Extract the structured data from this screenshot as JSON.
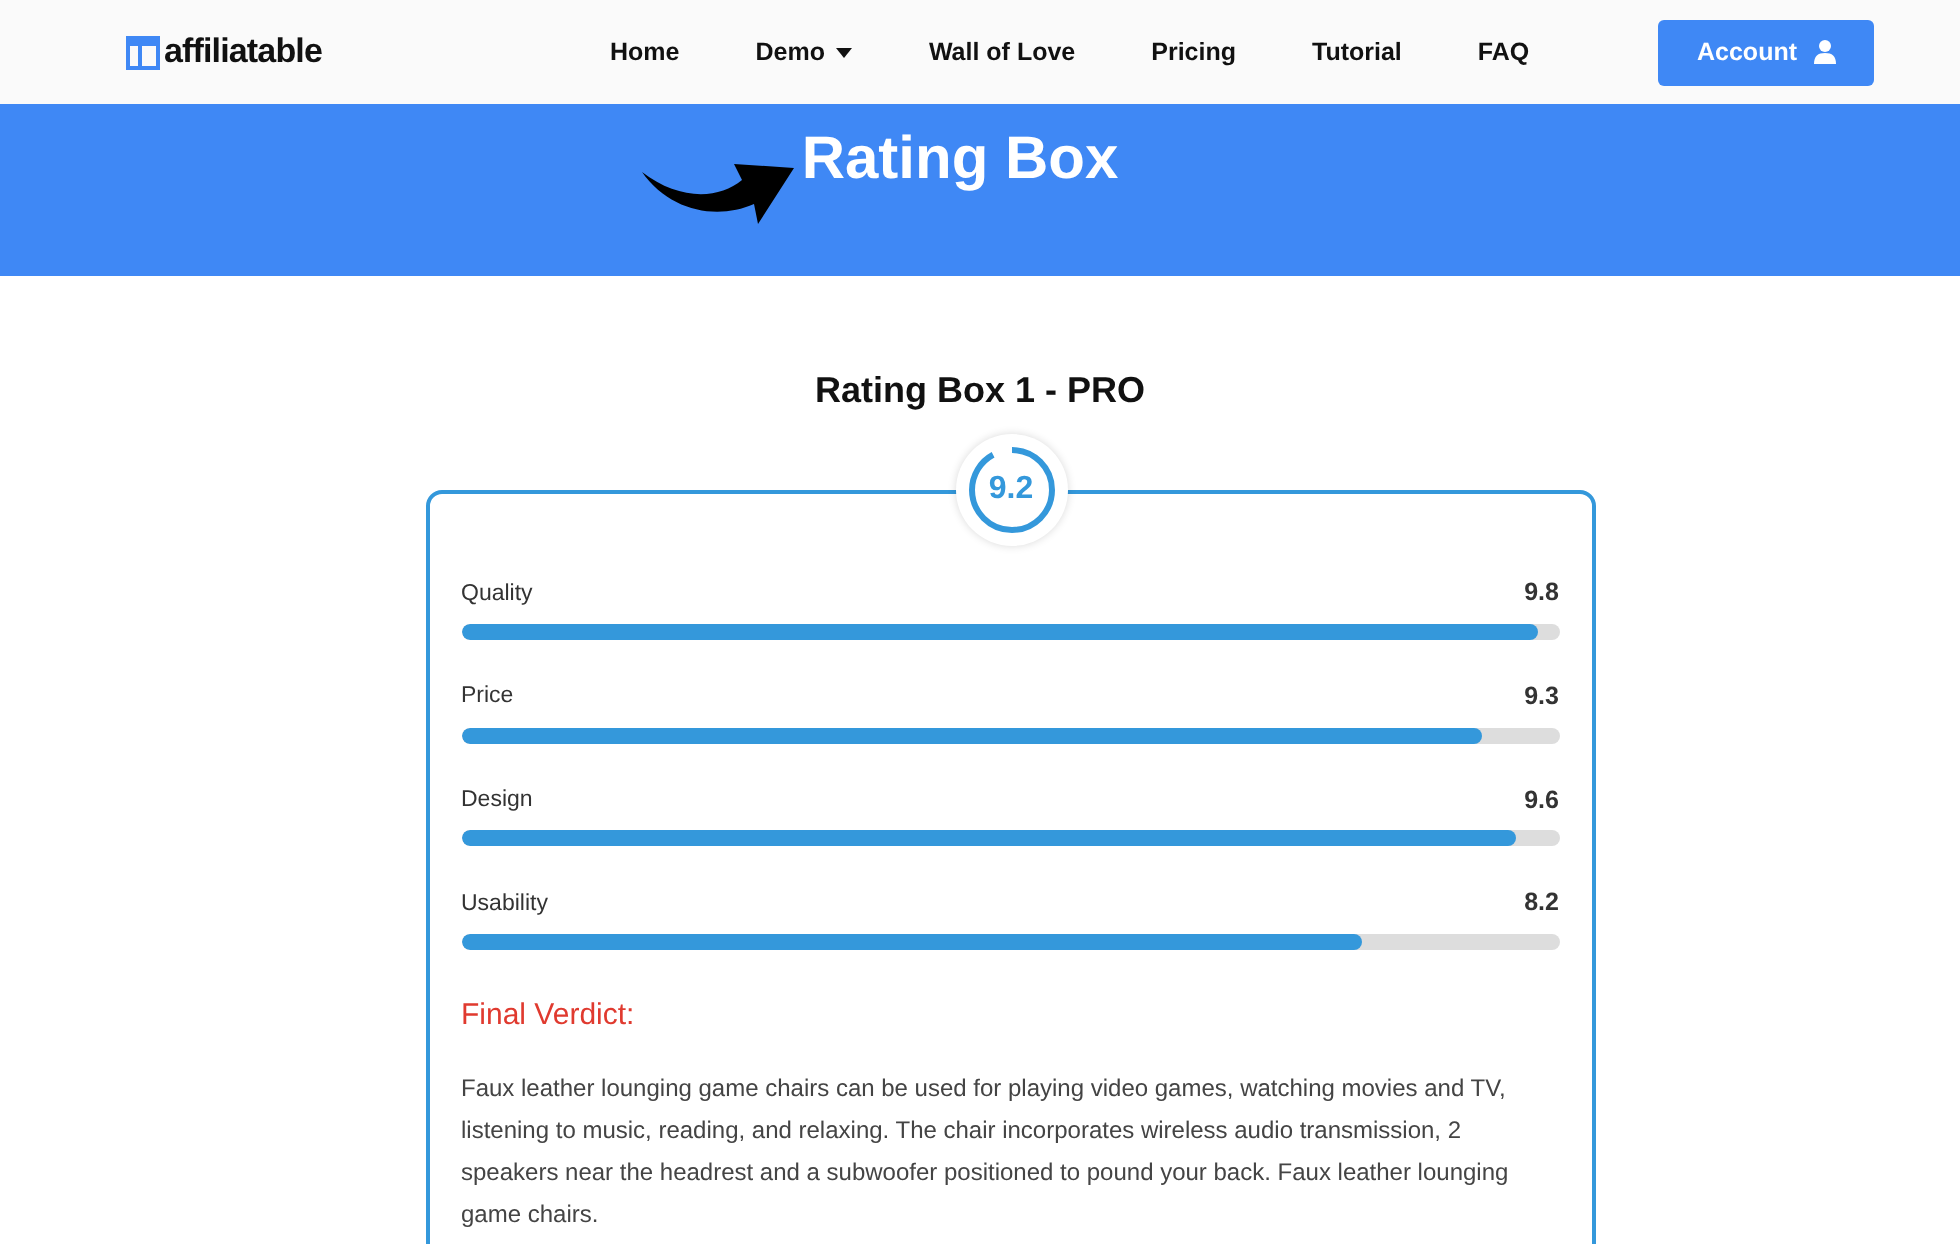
{
  "nav": {
    "logo": "affiliatable",
    "links": [
      {
        "label": "Home",
        "dropdown": false
      },
      {
        "label": "Demo",
        "dropdown": true
      },
      {
        "label": "Wall of Love",
        "dropdown": false
      },
      {
        "label": "Pricing",
        "dropdown": false
      },
      {
        "label": "Tutorial",
        "dropdown": false
      },
      {
        "label": "FAQ",
        "dropdown": false
      }
    ],
    "account_button": "Account"
  },
  "hero": {
    "title": "Rating Box"
  },
  "section_title": "Rating Box 1 - PRO",
  "rating_box": {
    "score": "9.2",
    "level": 0.92,
    "criteria": [
      {
        "name": "Quality",
        "reading": "9.8",
        "level": 0.98
      },
      {
        "name": "Price",
        "reading": "9.3",
        "level": 0.93
      },
      {
        "name": "Design",
        "reading": "9.6",
        "level": 0.96
      },
      {
        "name": "Usability",
        "reading": "8.2",
        "level": 0.82
      }
    ],
    "verdict_title": "Final Verdict:",
    "verdict_text": "Faux leather lounging game chairs can be used for playing video games, watching movies and TV, listening to music, reading, and relaxing. The chair incorporates wireless audio transmission, 2 speakers near the headrest and a subwoofer positioned to pound your back. Faux leather lounging game chairs."
  }
}
